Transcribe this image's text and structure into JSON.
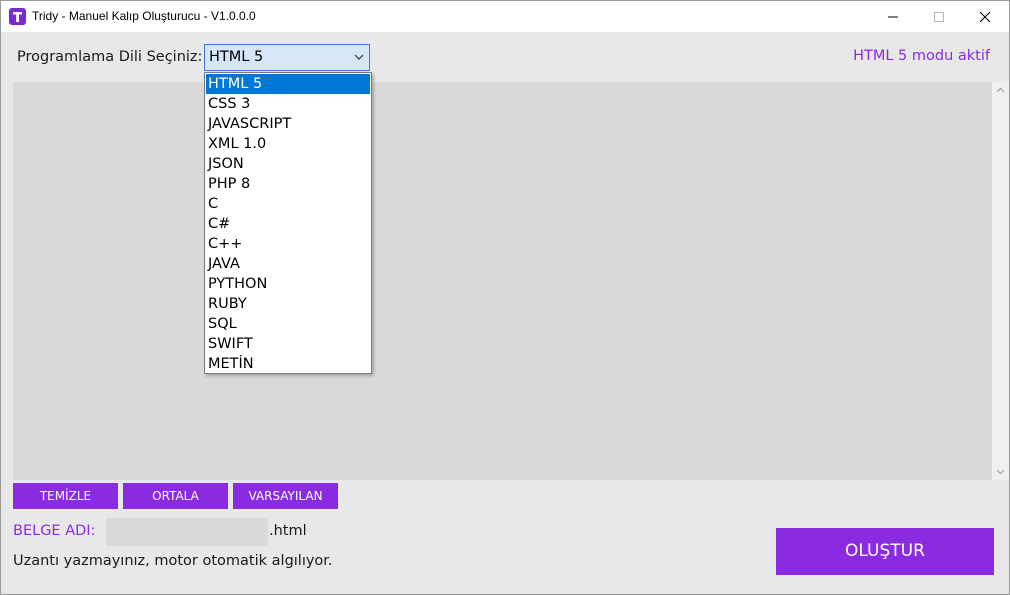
{
  "window": {
    "title": "Tridy - Manuel Kalıp Oluşturucu - V1.0.0.0",
    "app_icon": "app-logo-t-icon",
    "controls": [
      "minimize-icon",
      "maximize-icon",
      "close-icon"
    ]
  },
  "header": {
    "language_label": "Programlama Dili Seçiniz:",
    "selected_language": "HTML 5",
    "status": "HTML 5 modu aktif"
  },
  "dropdown": {
    "options": [
      "HTML 5",
      "CSS 3",
      "JAVASCRIPT",
      "XML 1.0",
      "JSON",
      "PHP 8",
      "C",
      "C#",
      "C++",
      "JAVA",
      "PYTHON",
      "RUBY",
      "SQL",
      "SWIFT",
      "METİN"
    ],
    "highlighted": "HTML 5"
  },
  "editor": {
    "content": ""
  },
  "buttons": {
    "clear": "TEMİZLE",
    "center": "ORTALA",
    "default": "VARSAYILAN",
    "create": "OLUŞTUR"
  },
  "footer": {
    "doc_name_label": "BELGE ADI:",
    "doc_name_value": "",
    "extension": ".html",
    "hint": "Uzantı yazmayınız, motor otomatik algılıyor."
  },
  "colors": {
    "accent": "#8a2be2",
    "selection": "#0078d7",
    "editor_bg": "#dadada",
    "window_bg": "#e8e8e8"
  }
}
